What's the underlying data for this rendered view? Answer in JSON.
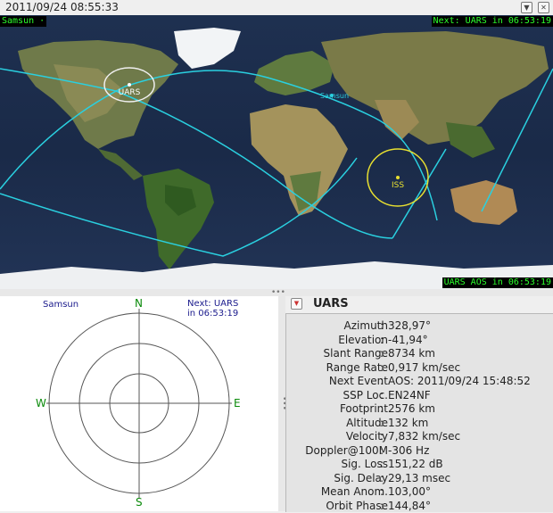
{
  "topbar": {
    "datetime": "2011/09/24 08:55:33",
    "menu_icon": "dropdown-icon",
    "close_icon": "close-icon"
  },
  "map": {
    "qth_label": "Samsun ·",
    "next_event": "Next: UARS in 06:53:19",
    "aos_label": "UARS AOS in 06:53:19",
    "satellites": [
      {
        "name": "UARS",
        "footprint_color": "#f0f0f0"
      },
      {
        "name": "ISS",
        "footprint_color": "#e8e030"
      }
    ],
    "location_label": "Samsun",
    "track_color": "#2ad0e0"
  },
  "polar": {
    "qth": "Samsun",
    "next_line1": "Next: UARS",
    "next_line2": "in 06:53:19",
    "north": "N",
    "south": "S",
    "east": "E",
    "west": "W"
  },
  "info": {
    "satellite": "UARS",
    "rows": [
      {
        "label": "Azimuth",
        "value": "328,97°"
      },
      {
        "label": "Elevation",
        "value": "-41,94°"
      },
      {
        "label": "Slant Range",
        "value": "8734 km"
      },
      {
        "label": "Range Rate",
        "value": "0,917 km/sec"
      },
      {
        "label": "Next Event",
        "value": "AOS: 2011/09/24 15:48:52"
      },
      {
        "label": "SSP Loc.",
        "value": "EN24NF"
      },
      {
        "label": "Footprint",
        "value": "2576 km"
      },
      {
        "label": "Altitude",
        "value": "132 km"
      },
      {
        "label": "Velocity",
        "value": "7,832 km/sec"
      },
      {
        "label": "Doppler@100M",
        "value": "-306 Hz"
      },
      {
        "label": "Sig. Loss",
        "value": "151,22 dB"
      },
      {
        "label": "Sig. Delay",
        "value": "29,13 msec"
      },
      {
        "label": "Mean Anom.",
        "value": "103,00°"
      },
      {
        "label": "Orbit Phase",
        "value": "144,84°"
      }
    ]
  }
}
